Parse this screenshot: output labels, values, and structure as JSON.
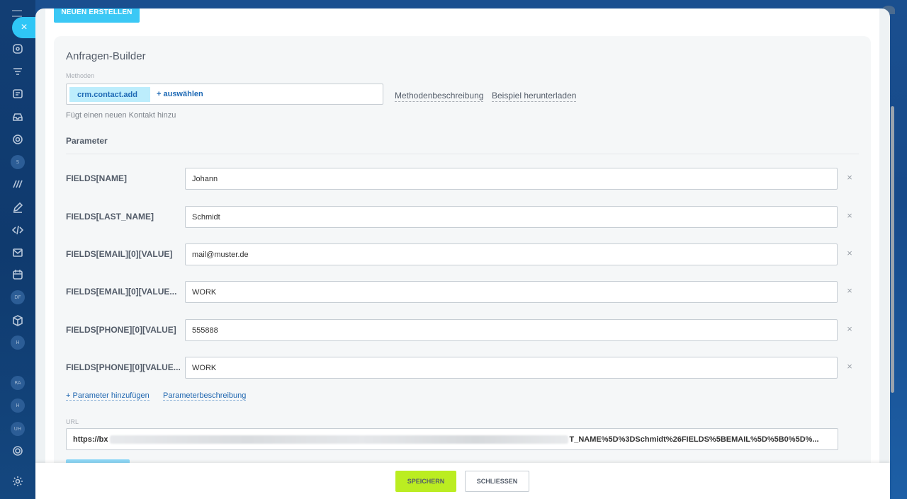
{
  "toolbar": {
    "create_label": "NEUEN ERSTELLEN"
  },
  "builder": {
    "title": "Anfragen-Builder",
    "methods_label": "Methoden",
    "method_tag": "crm.contact.add",
    "method_add": "+ auswählen",
    "method_description_link": "Methodenbeschreibung",
    "download_example_link": "Beispiel herunterladen",
    "method_description": "Fügt einen neuen Kontakt hinzu",
    "params_title": "Parameter",
    "params": [
      {
        "name": "FIELDS[NAME]",
        "value": "Johann"
      },
      {
        "name": "FIELDS[LAST_NAME]",
        "value": "Schmidt"
      },
      {
        "name": "FIELDS[EMAIL][0][VALUE]",
        "value": "mail@muster.de"
      },
      {
        "name": "FIELDS[EMAIL][0][VALUE...",
        "value": "WORK"
      },
      {
        "name": "FIELDS[PHONE][0][VALUE]",
        "value": "555888"
      },
      {
        "name": "FIELDS[PHONE][0][VALUE...",
        "value": "WORK"
      }
    ],
    "remove_symbol": "×",
    "add_param_link": "+ Parameter hinzufügen",
    "param_description_link": "Parameterbeschreibung",
    "url_label": "URL",
    "url_prefix": "https://bx",
    "url_suffix": "T_NAME%5D%3DSchmidt%26FIELDS%5BEMAIL%5D%5B0%5D%..."
  },
  "footer": {
    "save_label": "SPEICHERN",
    "close_label": "SCHLIESSEN"
  },
  "sidebar": {
    "close_symbol": "×",
    "badges": [
      "S",
      "DF",
      "H",
      "RA",
      "H",
      "UH"
    ]
  },
  "colors": {
    "accent": "#3bc8f5",
    "save": "#bbed21",
    "tag_bg": "#bcedfc",
    "link": "#2067b0"
  }
}
